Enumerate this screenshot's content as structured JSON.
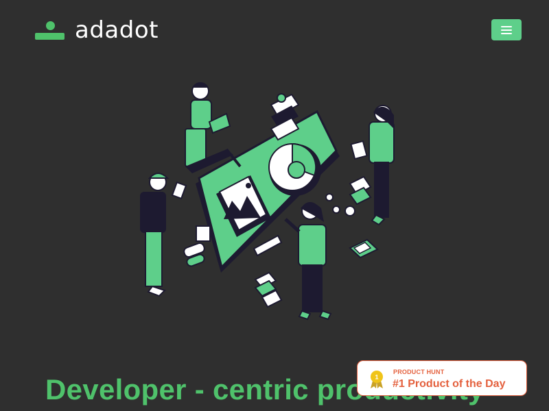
{
  "brand": {
    "name": "adadot",
    "accent_color": "#4fc26b",
    "background_color": "#2f2f2f"
  },
  "header": {
    "menu_icon": "hamburger-menu-icon",
    "menu_button_color": "#5ecf8a"
  },
  "hero": {
    "illustration": "isometric-team-dashboard-illustration",
    "headline": "Developer - centric productivity"
  },
  "product_hunt_badge": {
    "label": "PRODUCT HUNT",
    "title": "#1 Product of the Day",
    "medal_number": "1",
    "color": "#e4603d",
    "medal_icon": "gold-medal-icon"
  }
}
